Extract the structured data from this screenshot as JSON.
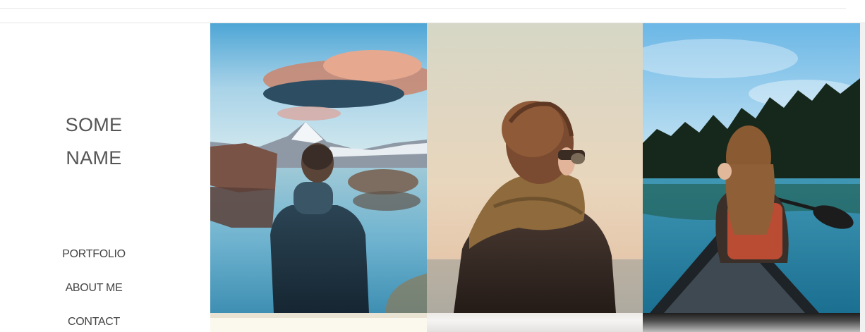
{
  "site": {
    "title_line1": "SOME",
    "title_line2": "NAME"
  },
  "nav": {
    "items": [
      {
        "label": "PORTFOLIO"
      },
      {
        "label": "ABOUT ME"
      },
      {
        "label": "CONTACT"
      }
    ]
  },
  "gallery": {
    "photos": [
      {
        "subject": "man-in-puffer-jacket-at-mountain-lake"
      },
      {
        "subject": "woman-with-scarf-and-sunglasses"
      },
      {
        "subject": "woman-in-canoe-on-lake"
      }
    ]
  },
  "colors": {
    "text": "#555555",
    "divider": "#e4e4e4",
    "background": "#ffffff"
  }
}
